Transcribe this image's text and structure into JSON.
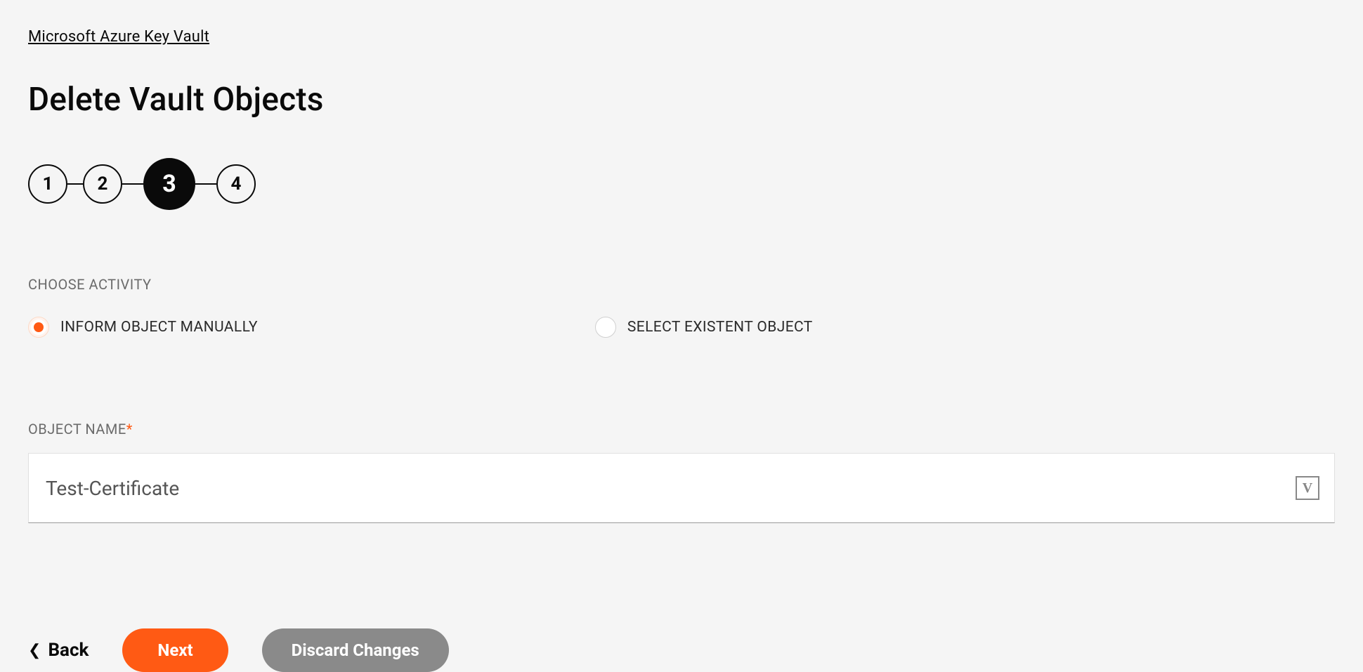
{
  "breadcrumb": {
    "label": "Microsoft Azure Key Vault"
  },
  "page": {
    "title": "Delete Vault Objects"
  },
  "stepper": {
    "steps": [
      "1",
      "2",
      "3",
      "4"
    ],
    "active_index": 2
  },
  "activity": {
    "section_label": "CHOOSE ACTIVITY",
    "options": [
      {
        "label": "INFORM OBJECT MANUALLY",
        "selected": true
      },
      {
        "label": "SELECT EXISTENT OBJECT",
        "selected": false
      }
    ]
  },
  "object_name": {
    "label": "OBJECT NAME",
    "required_marker": "*",
    "value": "Test-Certificate",
    "suffix_icon_text": "V"
  },
  "buttons": {
    "back": "Back",
    "next": "Next",
    "discard": "Discard Changes"
  }
}
